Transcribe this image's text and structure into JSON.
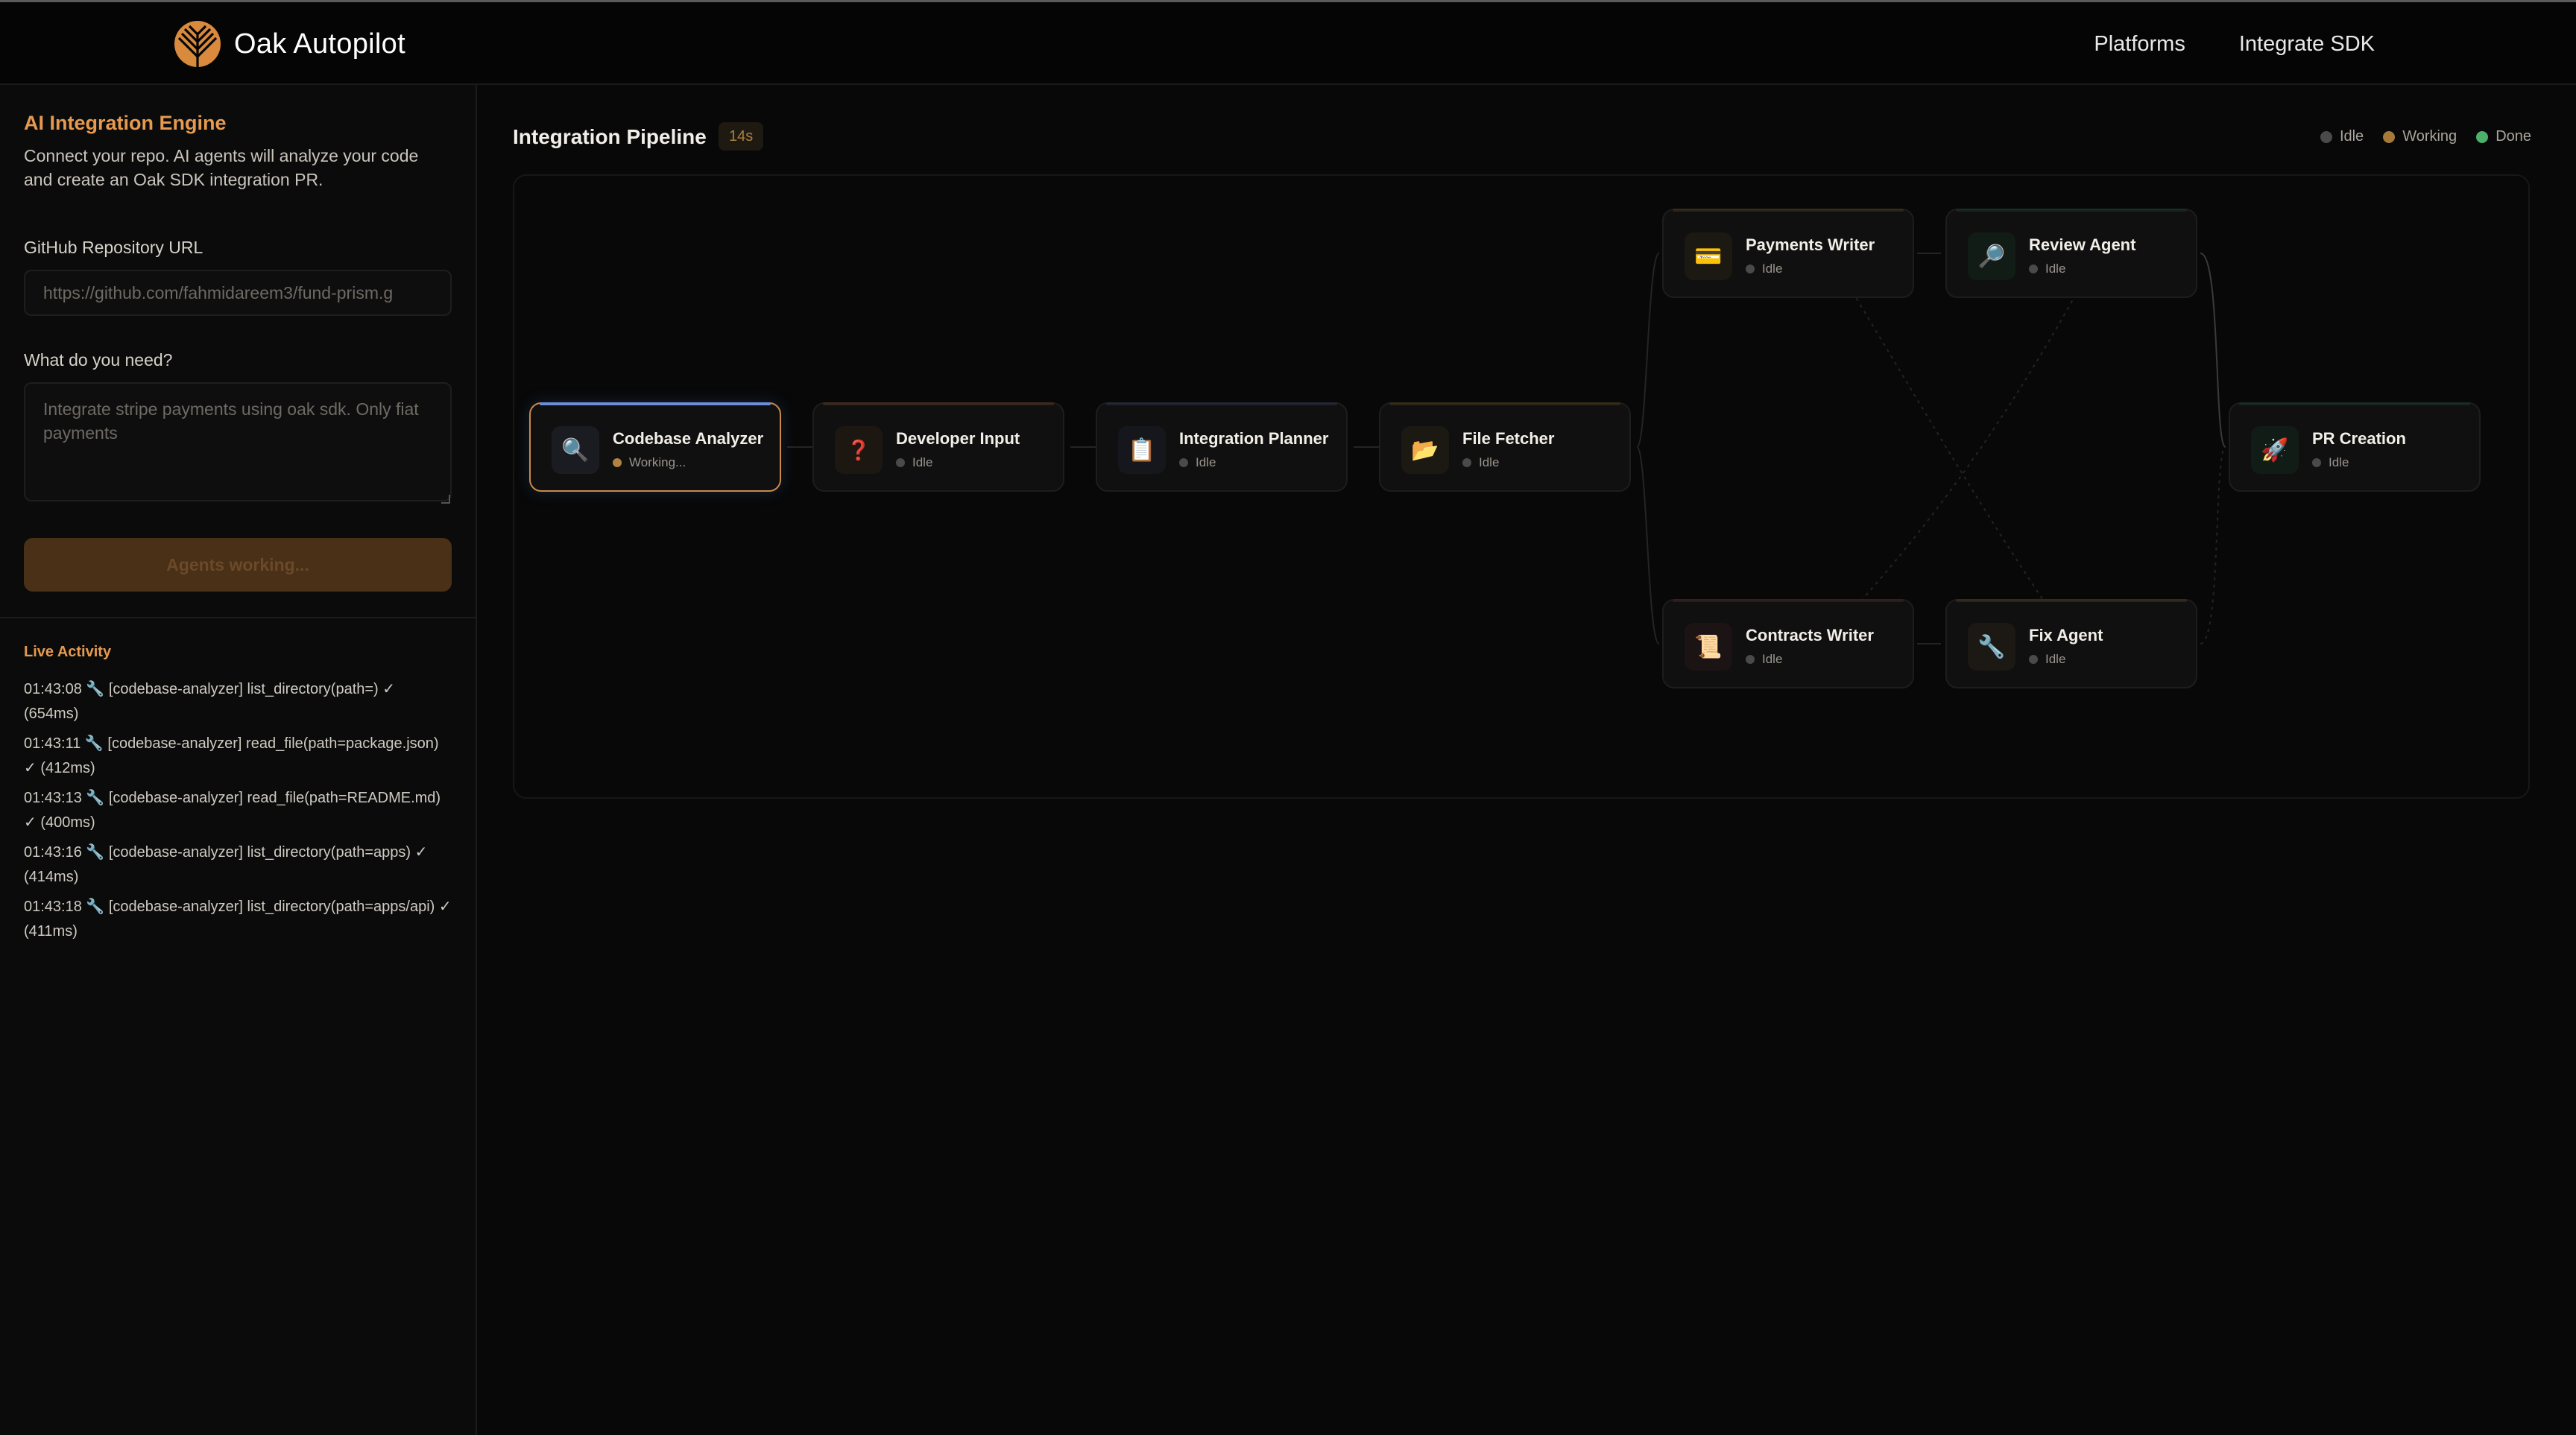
{
  "app": {
    "name": "Oak Autopilot",
    "nav": [
      "Platforms",
      "Integrate SDK"
    ]
  },
  "sidebar": {
    "title": "AI Integration Engine",
    "description": "Connect your repo. AI agents will analyze your code and create an Oak SDK integration PR.",
    "repo_label": "GitHub Repository URL",
    "repo_value": "https://github.com/fahmidareem3/fund-prism.g",
    "need_label": "What do you need?",
    "need_value": "Integrate stripe payments using oak sdk. Only fiat payments",
    "button_label": "Agents working...",
    "activity_title": "Live Activity",
    "activity": [
      "01:43:08 🔧 [codebase-analyzer] list_directory(path=) ✓ (654ms)",
      "01:43:11 🔧 [codebase-analyzer] read_file(path=package.json) ✓ (412ms)",
      "01:43:13 🔧 [codebase-analyzer] read_file(path=README.md) ✓ (400ms)",
      "01:43:16 🔧 [codebase-analyzer] list_directory(path=apps) ✓ (414ms)",
      "01:43:18 🔧 [codebase-analyzer] list_directory(path=apps/api) ✓ (411ms)"
    ]
  },
  "pipeline": {
    "title": "Integration Pipeline",
    "elapsed": "14s",
    "legend": [
      {
        "label": "Idle",
        "color": "#4a4a4a"
      },
      {
        "label": "Working",
        "color": "#a6793a"
      },
      {
        "label": "Done",
        "color": "#4caf6a"
      }
    ],
    "nodes": {
      "codebase_analyzer": {
        "name": "Codebase Analyzer",
        "status": "Working...",
        "icon": "magnifier-icon",
        "glyph": "🔍"
      },
      "developer_input": {
        "name": "Developer Input",
        "status": "Idle",
        "icon": "question-icon",
        "glyph": "❓"
      },
      "integration_planner": {
        "name": "Integration Planner",
        "status": "Idle",
        "icon": "clipboard-icon",
        "glyph": "📋"
      },
      "file_fetcher": {
        "name": "File Fetcher",
        "status": "Idle",
        "icon": "folder-icon",
        "glyph": "📂"
      },
      "payments_writer": {
        "name": "Payments Writer",
        "status": "Idle",
        "icon": "credit-card-icon",
        "glyph": "💳"
      },
      "review_agent": {
        "name": "Review Agent",
        "status": "Idle",
        "icon": "magnifier-right-icon",
        "glyph": "🔎"
      },
      "contracts_writer": {
        "name": "Contracts Writer",
        "status": "Idle",
        "icon": "scroll-icon",
        "glyph": "📜"
      },
      "fix_agent": {
        "name": "Fix Agent",
        "status": "Idle",
        "icon": "wrench-icon",
        "glyph": "🔧"
      },
      "pr_creation": {
        "name": "PR Creation",
        "status": "Idle",
        "icon": "rocket-icon",
        "glyph": "🚀"
      }
    }
  }
}
